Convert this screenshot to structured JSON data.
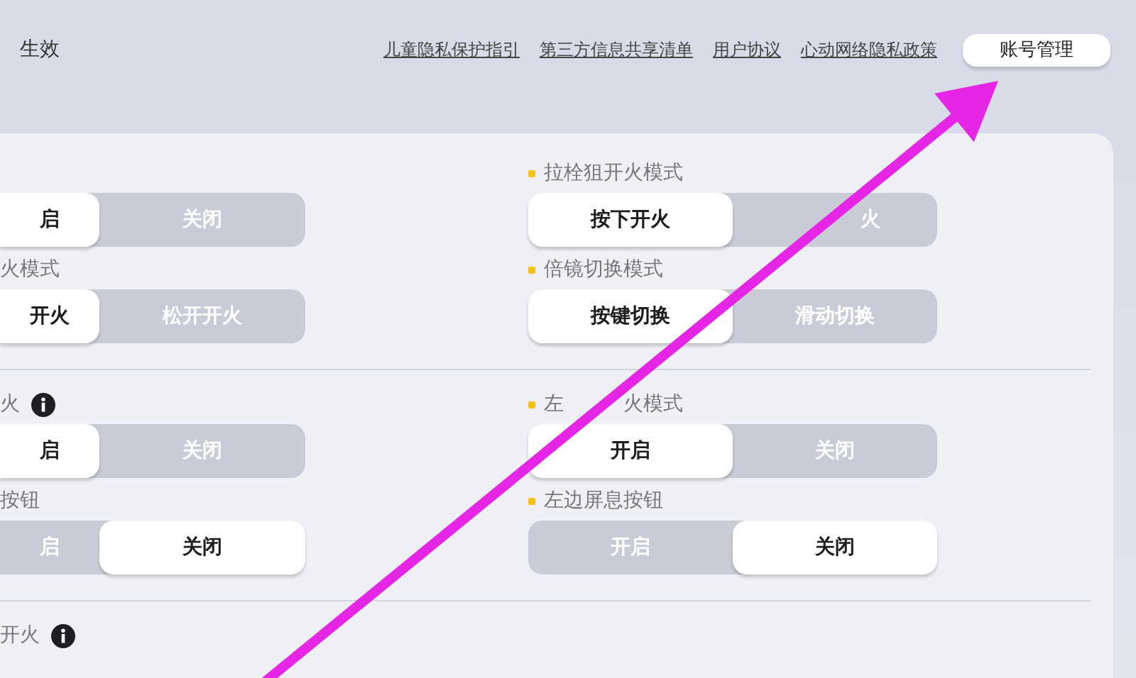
{
  "header": {
    "notice": "生效",
    "links": [
      "儿童隐私保护指引",
      "第三方信息共享清单",
      "用户协议",
      "心动网络隐私政策"
    ],
    "account_button": "账号管理"
  },
  "sections": [
    {
      "left": [
        {
          "options": [
            {
              "label": "启",
              "selected": true
            },
            {
              "label": "关闭",
              "selected": false
            }
          ]
        },
        {
          "label": "火模式",
          "options": [
            {
              "label": "开火",
              "selected": true
            },
            {
              "label": "松开开火",
              "selected": false
            }
          ]
        }
      ],
      "right": [
        {
          "label": "拉栓狙开火模式",
          "dot": true,
          "options": [
            {
              "label": "按下开火",
              "selected": true
            },
            {
              "label": "火",
              "selected": false,
              "kind": "partial"
            }
          ]
        },
        {
          "label": "倍镜切换模式",
          "dot": true,
          "options": [
            {
              "label": "按键切换",
              "selected": true
            },
            {
              "label": "滑动切换",
              "selected": false
            }
          ]
        }
      ]
    },
    {
      "left": [
        {
          "label": "火",
          "info": true,
          "options": [
            {
              "label": "启",
              "selected": true
            },
            {
              "label": "关闭",
              "selected": false
            }
          ]
        },
        {
          "label": "按钮",
          "options": [
            {
              "label": "启",
              "selected": false
            },
            {
              "label": "关闭",
              "selected": true
            }
          ]
        }
      ],
      "right": [
        {
          "label_parts": [
            "左",
            "火模式"
          ],
          "dot": true,
          "options": [
            {
              "label": "开启",
              "selected": true
            },
            {
              "label": "关闭",
              "selected": false
            }
          ]
        },
        {
          "label": "左边屏息按钮",
          "dot": true,
          "options": [
            {
              "label": "开启",
              "selected": false
            },
            {
              "label": "关闭",
              "selected": true
            }
          ]
        }
      ]
    },
    {
      "left": [
        {
          "label": "开火",
          "info": true
        }
      ]
    }
  ]
}
